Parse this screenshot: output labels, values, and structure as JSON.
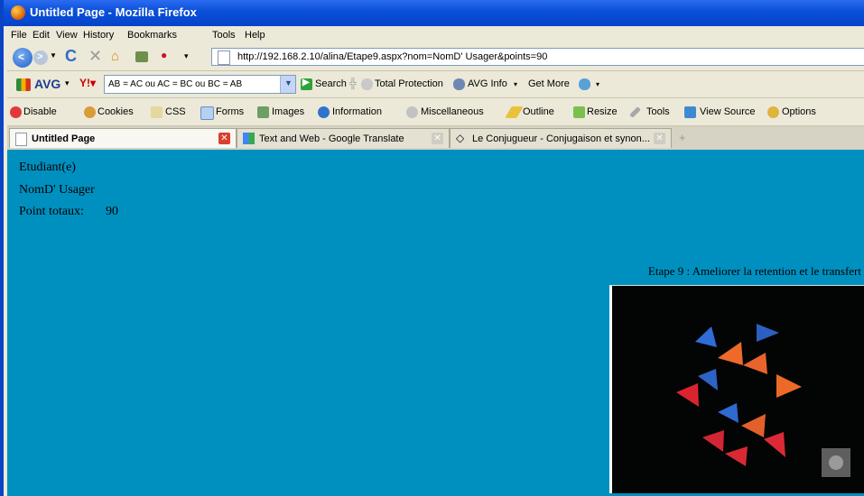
{
  "window": {
    "title": "Untitled Page - Mozilla Firefox"
  },
  "menu": [
    "File",
    "Edit",
    "View",
    "History",
    "Bookmarks",
    "Tools",
    "Help"
  ],
  "nav": {
    "url": "http://192.168.2.10/alina/Etape9.aspx?nom=NomD' Usager&points=90"
  },
  "avg_toolbar": {
    "brand": "AVG",
    "search_value": "AB = AC ou AC = BC ou BC = AB",
    "search_label": "Search",
    "total_protection": "Total Protection",
    "avg_info": "AVG Info",
    "get_more": "Get More"
  },
  "webdev_toolbar": [
    "Disable",
    "Cookies",
    "CSS",
    "Forms",
    "Images",
    "Information",
    "Miscellaneous",
    "Outline",
    "Resize",
    "Tools",
    "View Source",
    "Options"
  ],
  "tabs": [
    {
      "label": "Untitled Page",
      "active": true
    },
    {
      "label": "Text and Web - Google Translate",
      "active": false
    },
    {
      "label": "Le Conjugueur - Conjugaison et synon...",
      "active": false
    }
  ],
  "page": {
    "student_label": "Etudiant(e)",
    "username": "NomD' Usager",
    "points_label": "Point totaux:",
    "points_value": "90",
    "step_title": "Etape 9 : Ameliorer la retention et le transfert"
  },
  "colors": {
    "page_bg": "#0090c0",
    "title_bar": "#0a4fd8"
  }
}
